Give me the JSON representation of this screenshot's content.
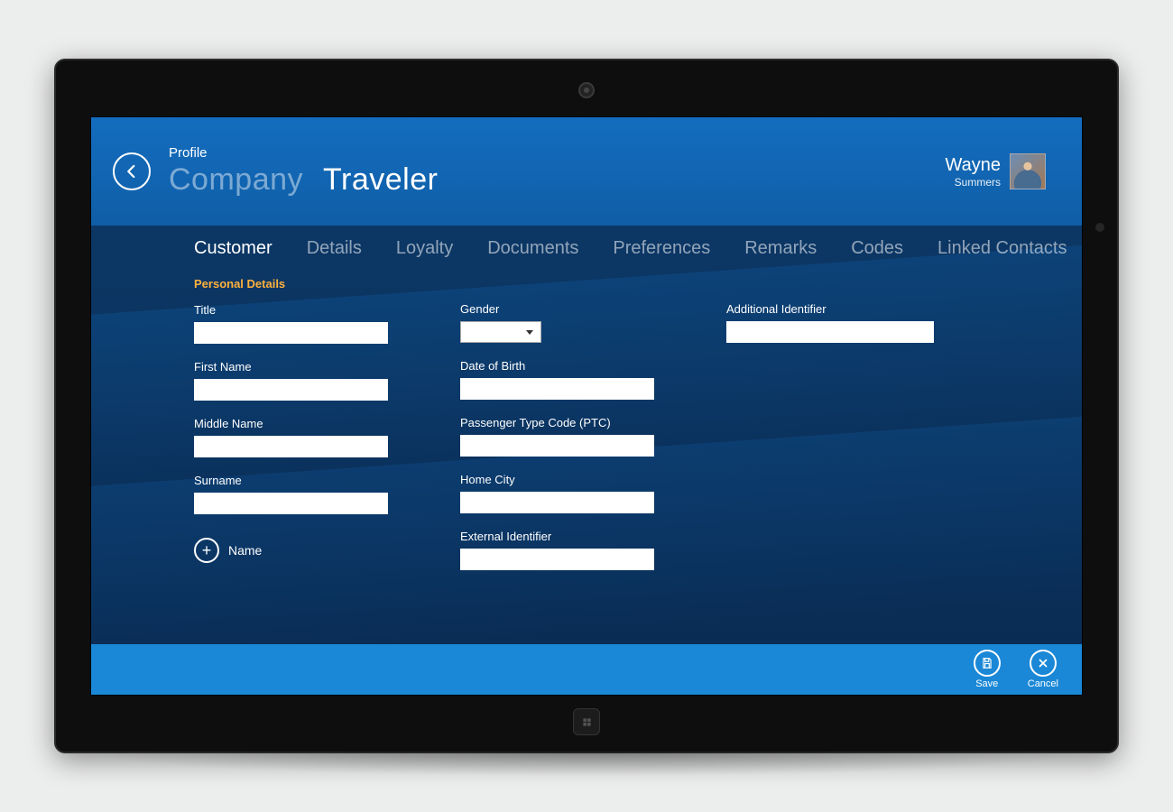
{
  "header": {
    "profile_label": "Profile",
    "breadcrumb_company": "Company",
    "breadcrumb_traveler": "Traveler",
    "user_first": "Wayne",
    "user_last": "Summers"
  },
  "tabs": {
    "items": [
      {
        "label": "Customer",
        "active": true
      },
      {
        "label": "Details",
        "active": false
      },
      {
        "label": "Loyalty",
        "active": false
      },
      {
        "label": "Documents",
        "active": false
      },
      {
        "label": "Preferences",
        "active": false
      },
      {
        "label": "Remarks",
        "active": false
      },
      {
        "label": "Codes",
        "active": false
      },
      {
        "label": "Linked Contacts",
        "active": false
      }
    ]
  },
  "form": {
    "section_title": "Personal Details",
    "title_label": "Title",
    "first_name_label": "First Name",
    "middle_name_label": "Middle Name",
    "surname_label": "Surname",
    "add_name_label": "Name",
    "gender_label": "Gender",
    "dob_label": "Date of Birth",
    "ptc_label": "Passenger Type Code (PTC)",
    "home_city_label": "Home City",
    "external_id_label": "External Identifier",
    "additional_id_label": "Additional Identifier",
    "values": {
      "title": "",
      "first_name": "",
      "middle_name": "",
      "surname": "",
      "gender": "",
      "dob": "",
      "ptc": "",
      "home_city": "",
      "external_id": "",
      "additional_id": ""
    }
  },
  "footer": {
    "save_label": "Save",
    "cancel_label": "Cancel"
  }
}
